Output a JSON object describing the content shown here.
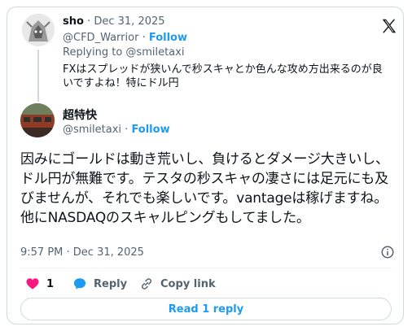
{
  "parent": {
    "name": "sho",
    "date": "· Dec 31, 2025",
    "handle": "@CFD_Warrior",
    "follow": "Follow",
    "follow_sep": " · ",
    "replying": "Replying to @smiletaxi",
    "text": "FXはスプレッドが狭いんで秒スキャとか色んな攻め方出来るのが良いですよね！特にドル円"
  },
  "tweet": {
    "name": "超特快",
    "handle": "@smiletaxi",
    "follow_sep": " · ",
    "follow": "Follow",
    "text": "因みにゴールドは動き荒いし、負けるとダメージ大きいし、ドル円が無難です。テスタの秒スキャの凄さには足元にも及びませんが、それでも楽しいです。vantageは稼げますね。他にNASDAQのスキャルピングもしてました。",
    "timestamp": "9:57 PM · Dec 31, 2025"
  },
  "actions": {
    "like_count": "1",
    "reply_label": "Reply",
    "copy_label": "Copy link"
  },
  "read_button": "Read 1 reply",
  "colors": {
    "accent": "#1d9bf0",
    "like": "#f91880",
    "muted": "#536471"
  },
  "icons": [
    "x-logo-icon",
    "info-icon",
    "heart-icon",
    "reply-bubble-icon",
    "link-icon"
  ]
}
